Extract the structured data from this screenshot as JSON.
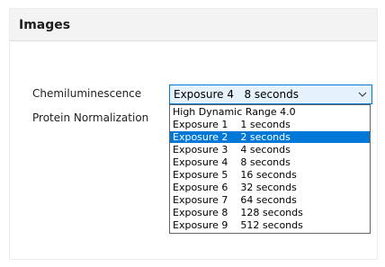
{
  "panel": {
    "title": "Images"
  },
  "fields": {
    "chemiluminescence_label": "Chemiluminescence",
    "protein_normalization_label": "Protein Normalization"
  },
  "combo": {
    "selected_value": "Exposure 4   8 seconds",
    "arrow_icon": "chevron-down-icon"
  },
  "dropdown": {
    "selected_index": 2,
    "options": [
      "High Dynamic Range 4.0",
      "Exposure 1    1 seconds",
      "Exposure 2    2 seconds",
      "Exposure 3    4 seconds",
      "Exposure 4    8 seconds",
      "Exposure 5    16 seconds",
      "Exposure 6    32 seconds",
      "Exposure 7    64 seconds",
      "Exposure 8    128 seconds",
      "Exposure 9    512 seconds"
    ]
  },
  "colors": {
    "selection": "#0078d7",
    "combo_background": "#e5f1fb",
    "header_background": "#f3f3f3"
  }
}
